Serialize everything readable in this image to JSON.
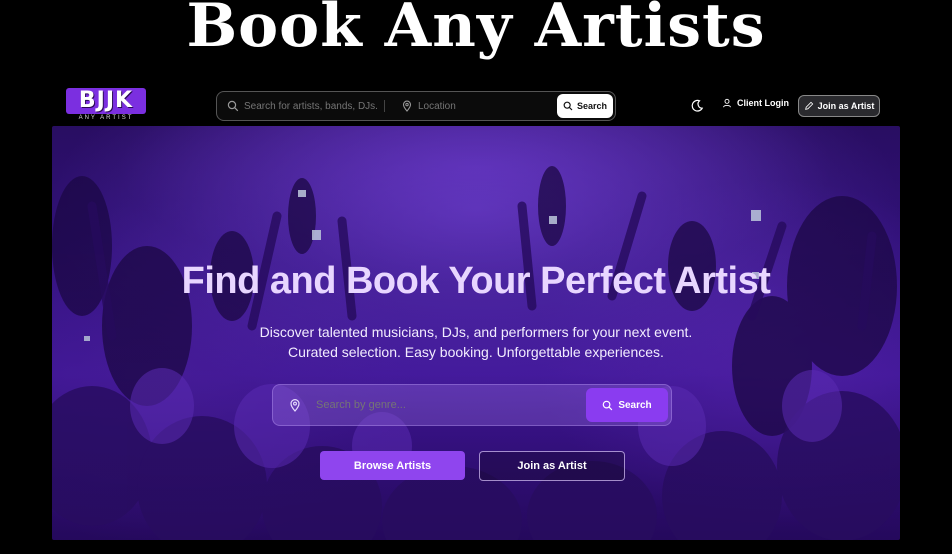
{
  "promo": {
    "title": "Book Any Artists"
  },
  "navbar": {
    "logo_text": "BJJK",
    "logo_tagline": "ANY ARTIST",
    "search_placeholder": "Search for artists, bands, DJs.",
    "location_placeholder": "Location",
    "search_button": "Search",
    "client_login": "Client Login",
    "join_button": "Join as Artist"
  },
  "hero": {
    "title": "Find and Book Your Perfect Artist",
    "subtitle_line1": "Discover talented musicians, DJs, and performers for your next event.",
    "subtitle_line2": "Curated selection. Easy booking. Unforgettable experiences.",
    "search_placeholder": "Search by genre...",
    "search_button": "Search",
    "browse_button": "Browse Artists",
    "join_button": "Join as Artist"
  },
  "colors": {
    "accent": "#8f45ee",
    "logo_bg": "#7b2fe0",
    "background": "#000000"
  },
  "icons": [
    "search-icon",
    "location-pin-icon",
    "moon-icon",
    "user-icon",
    "pen-icon"
  ]
}
